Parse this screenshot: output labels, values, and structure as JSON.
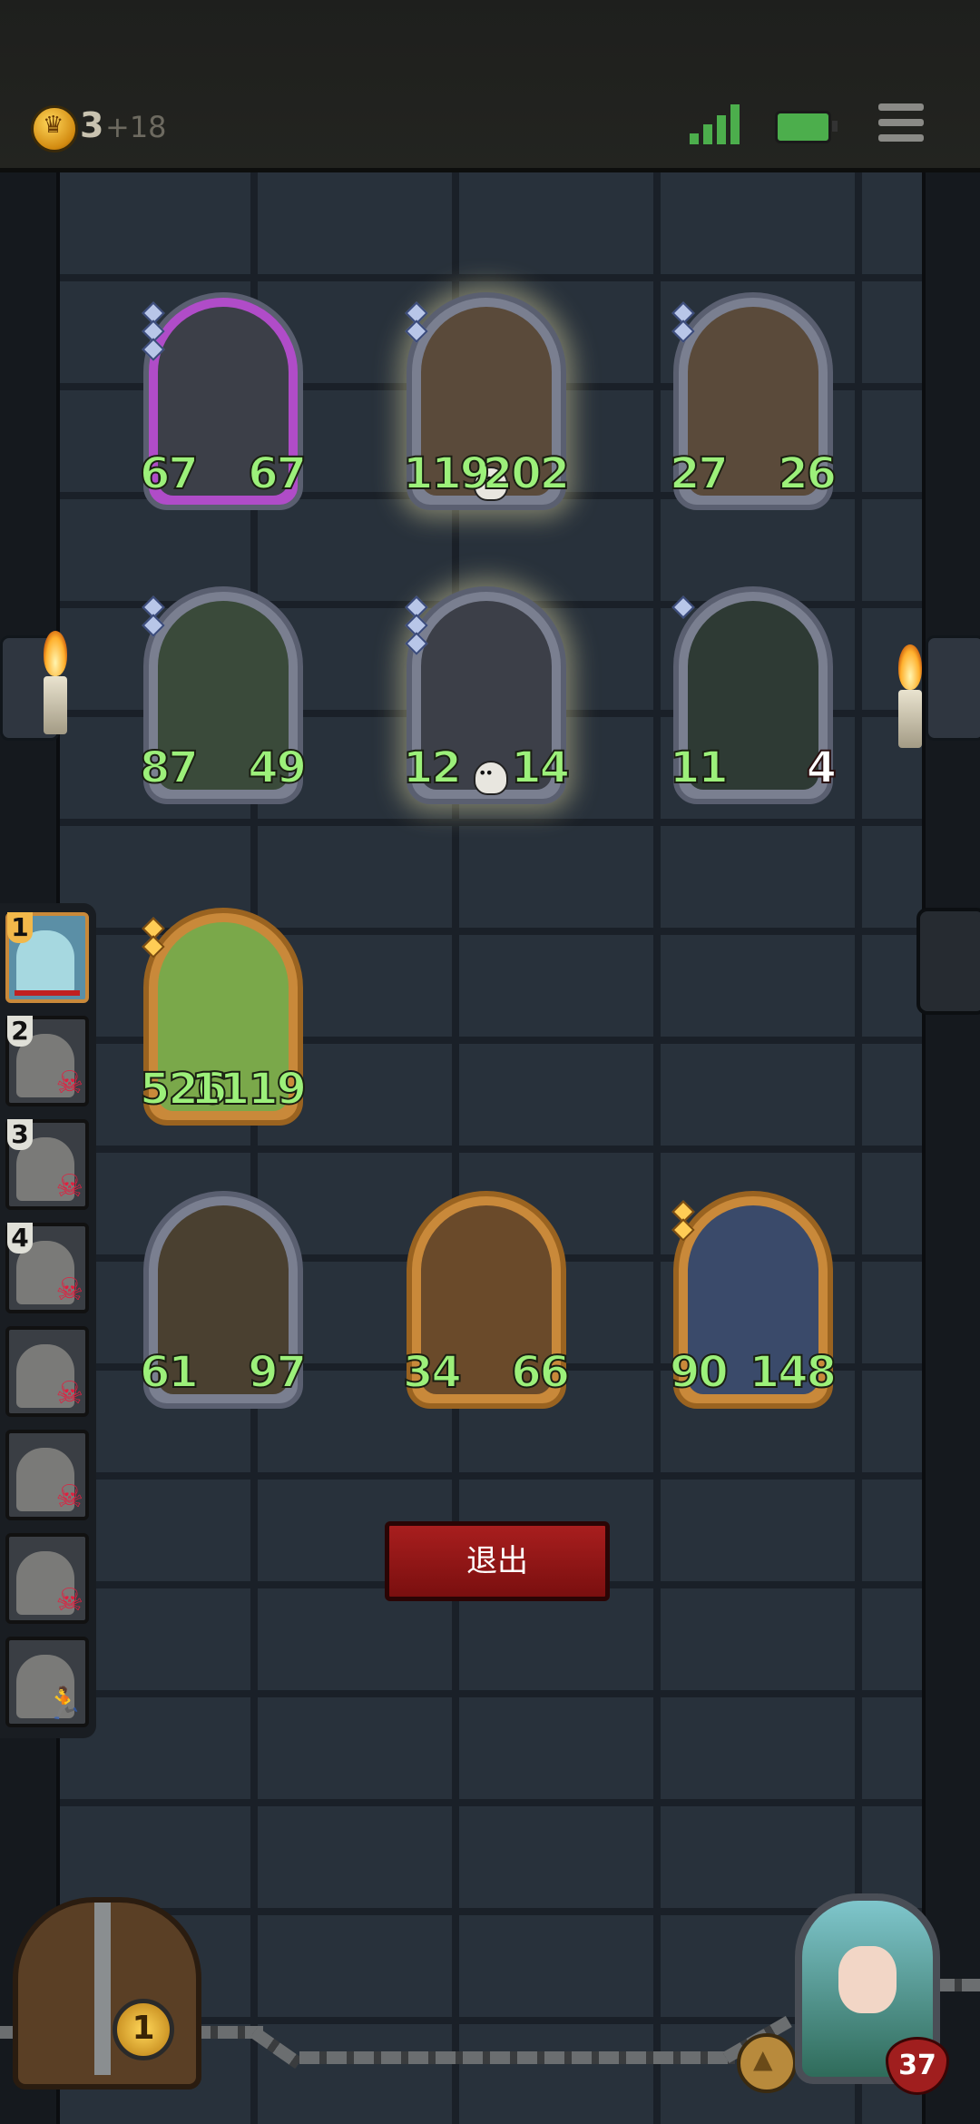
{
  "status_bar": {
    "gold": "3",
    "gold_bonus": "+18"
  },
  "board": {
    "enemy_row1": [
      {
        "name": "armored-knight",
        "attack": "67",
        "health": "67",
        "gems": 3,
        "frame": "purple"
      },
      {
        "name": "red-box-robot",
        "attack": "119",
        "health": "202",
        "gems": 2,
        "frame": "gray",
        "skull": true,
        "glow": true
      },
      {
        "name": "red-box-robot",
        "attack": "27",
        "health": "26",
        "gems": 2,
        "frame": "gray"
      }
    ],
    "enemy_row2": [
      {
        "name": "fanged-plant",
        "attack": "87",
        "health": "49",
        "gems": 2,
        "frame": "gray"
      },
      {
        "name": "armored-knight",
        "attack": "12",
        "health": "14",
        "gems": 3,
        "frame": "gray",
        "skull": true,
        "glow": true
      },
      {
        "name": "skeleton-shadow",
        "attack": "11",
        "health": "4",
        "gems": 1,
        "frame": "gray"
      }
    ],
    "player_row1": [
      {
        "name": "leaf-child",
        "attack": "526",
        "health": "1119",
        "gems": 2,
        "frame": "gold"
      }
    ],
    "player_row2": [
      {
        "name": "witch-goblin",
        "attack": "61",
        "health": "97",
        "gems": 0,
        "frame": "gray"
      },
      {
        "name": "red-imp",
        "attack": "34",
        "health": "66",
        "gems": 0,
        "frame": "gold"
      },
      {
        "name": "elf-sorceress",
        "attack": "90",
        "health": "148",
        "gems": 2,
        "frame": "gold"
      }
    ]
  },
  "queue": [
    {
      "num": "1",
      "state": "active"
    },
    {
      "num": "2",
      "state": "dead"
    },
    {
      "num": "3",
      "state": "dead"
    },
    {
      "num": "4",
      "state": "dead"
    },
    {
      "num": "",
      "state": "dead"
    },
    {
      "num": "",
      "state": "dead"
    },
    {
      "num": "",
      "state": "dead"
    },
    {
      "num": "",
      "state": "fleeing"
    }
  ],
  "exit_button": "退出",
  "bottom": {
    "chest_count": "1",
    "hero_health": "37"
  },
  "colors": {
    "stat_green": "#9cf07a",
    "exit_red": "#a81e1e",
    "gold_frame": "#c9893a"
  }
}
